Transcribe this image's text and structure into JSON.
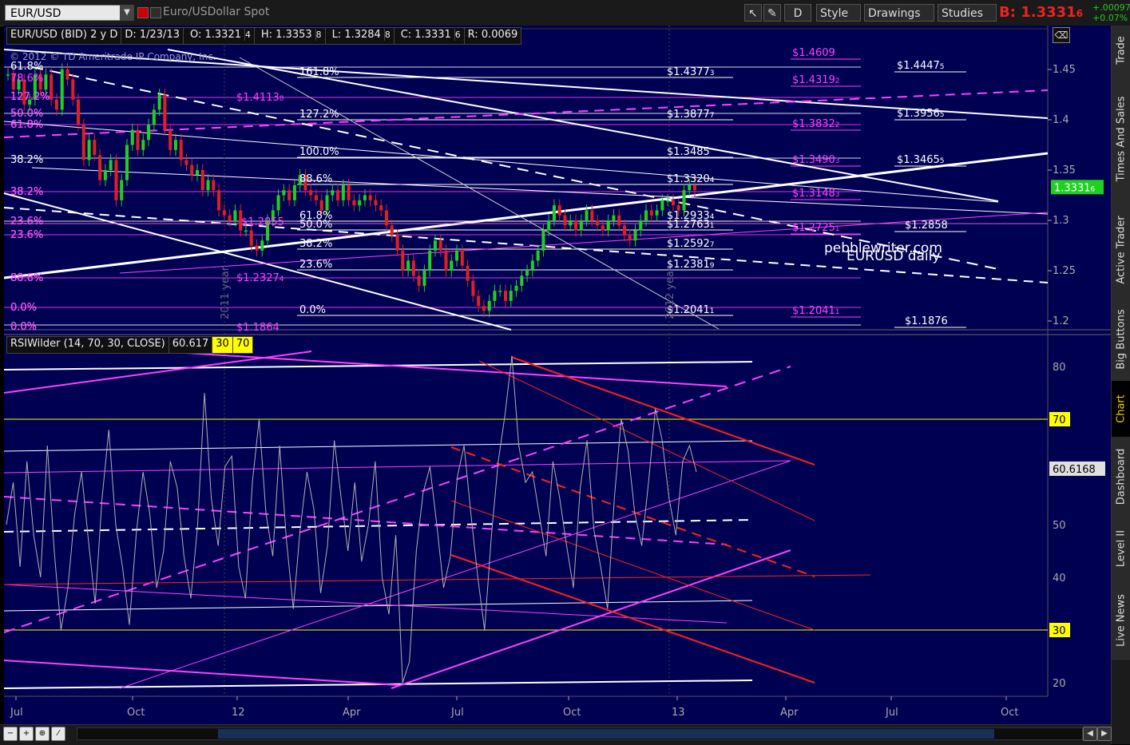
{
  "toolbar": {
    "symbol": "EUR/USD",
    "description": "Euro/USDollar Spot",
    "mode_label": "D",
    "style_label": "Style",
    "drawings_label": "Drawings",
    "studies_label": "Studies",
    "bid_prefix": "B:",
    "bid_price": "1.3331",
    "bid_frac": "6",
    "change_abs": "+.00097",
    "change_pct": "+0.07%"
  },
  "price_header": {
    "symbol_period": "EUR/USD (BID) 2 y D",
    "date": "D: 1/23/13",
    "open": "O: 1.3321",
    "open_frac": "4",
    "high": "H: 1.3353",
    "high_frac": "8",
    "low": "L: 1.3284",
    "low_frac": "8",
    "close": "C: 1.3331",
    "close_frac": "6",
    "range": "R: 0.0069"
  },
  "copyright": "© 2012 © TD Ameritrade IP Company, Inc.",
  "watermark": [
    "pebblewriter.com",
    "EURUSD daily"
  ],
  "price_axis": [
    "1.45",
    "1.4",
    "1.35",
    "1.3",
    "1.25",
    "1.2"
  ],
  "price_marker": "1.3331",
  "price_marker_frac": "6",
  "x_axis": [
    "Jul",
    "Oct",
    "12",
    "Apr",
    "Jul",
    "Oct",
    "13",
    "Apr",
    "Jul",
    "Oct"
  ],
  "year_labels": [
    "2011 year",
    "2012 year"
  ],
  "fib_left": [
    "61.8%",
    "38.2%",
    "50.0%",
    "127.2%",
    "61.8%",
    "38.2%",
    "23.6%",
    "23.6%",
    "0.0%",
    "88.6%",
    "0.0%"
  ],
  "fib_left_magenta": [
    "78.6%",
    "127.2%",
    "61.8%",
    "50.0%",
    "38.2%",
    "23.6%",
    "23.6%",
    "88.6%",
    "0.0%",
    "0.0%"
  ],
  "fib_mid": [
    "161.8%",
    "127.2%",
    "100.0%",
    "88.6%",
    "61.8%",
    "50.0%",
    "38.2%",
    "23.6%",
    "0.0%"
  ],
  "mid_prices": [
    "$1.4377",
    "$1.3877",
    "$1.3485",
    "$1.3320",
    "$1.2933",
    "$1.2763",
    "$1.2592",
    "$1.2381",
    "$1.2041"
  ],
  "mid_price_fracs": [
    "3",
    "7",
    "",
    "4",
    "4",
    "1",
    "7",
    "9",
    "1"
  ],
  "magenta_prices_right": [
    "$1.4609",
    "$1.4319",
    "$1.3832",
    "$1.3490",
    "$1.3148",
    "$1.2725",
    "$1.2041"
  ],
  "magenta_price_fracs": [
    "",
    "2",
    "2",
    "3",
    "3",
    "1",
    "1"
  ],
  "magenta_prices_left": [
    "$1.4113",
    "$1.2855",
    "$1.2327",
    "$1.1864"
  ],
  "magenta_left_fracs": [
    "8",
    "",
    "4",
    ""
  ],
  "white_prices_right": [
    "$1.4447",
    "$1.3956",
    "$1.3465",
    "$1.2858",
    "$1.1876"
  ],
  "white_right_fracs": [
    "5",
    "5",
    "5",
    "",
    ""
  ],
  "rsi_header": {
    "name": "RSIWilder (14, 70, 30, CLOSE)",
    "value": "60.617",
    "lower": "30",
    "upper": "70"
  },
  "rsi_axis": [
    "80",
    "70",
    "60",
    "50",
    "40",
    "30",
    "20"
  ],
  "rsi_marker": "60.6168",
  "sidebar_tabs": [
    "Trade",
    "Times And Sales",
    "Active Trader",
    "Big Buttons",
    "Chart",
    "Dashboard",
    "Level II",
    "Live News"
  ],
  "colors": {
    "background": "#000052",
    "candle_up": "#20d020",
    "candle_down": "#e02020",
    "fib": "#ff40ff",
    "accent": "#ffff00"
  }
}
